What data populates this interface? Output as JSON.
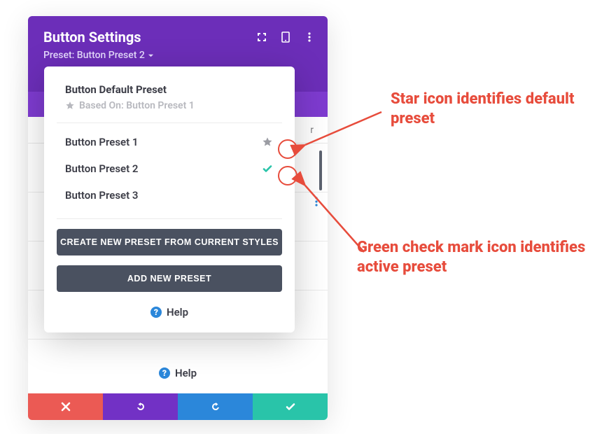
{
  "colors": {
    "purple_primary": "#6c2eb9",
    "purple_light": "#7e3bd0",
    "red": "#eb5a54",
    "blue": "#2b87da",
    "green": "#29c4a9",
    "dark_button": "#4a5160",
    "annotation_red": "#e74c3c"
  },
  "header": {
    "title": "Button Settings",
    "preset_label": "Preset: Button Preset 2"
  },
  "tab_hint": "r",
  "dropdown": {
    "default_title": "Button Default Preset",
    "based_on": "Based On: Button Preset 1",
    "items": [
      {
        "label": "Button Preset 1",
        "default": true,
        "active": false
      },
      {
        "label": "Button Preset 2",
        "default": false,
        "active": true
      },
      {
        "label": "Button Preset 3",
        "default": false,
        "active": false
      }
    ],
    "create_btn": "CREATE NEW PRESET FROM CURRENT STYLES",
    "add_btn": "ADD NEW PRESET",
    "help": "Help"
  },
  "panel_help": "Help",
  "annotations": {
    "star": "Star icon identifies default preset",
    "check": "Green check mark icon identifies active preset"
  }
}
